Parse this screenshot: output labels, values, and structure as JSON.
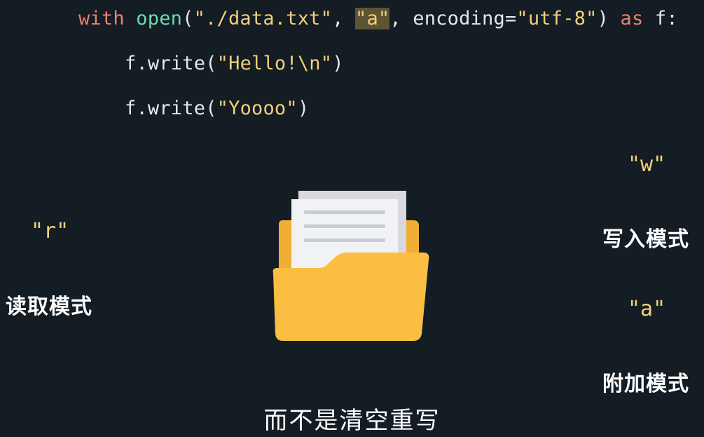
{
  "code": {
    "line1": {
      "kw_with": "with",
      "fn_open": "open",
      "p_open": "(",
      "path": "\"./data.txt\"",
      "comma1": ", ",
      "mode": "\"a\"",
      "rest": ", encoding=",
      "enc": "\"utf-8\"",
      "p_close": ") ",
      "kw_as": "as",
      "tail": " f:"
    },
    "line2": {
      "call": "f.write(",
      "arg": "\"Hello!\\n\"",
      "close": ")"
    },
    "line3": {
      "call": "f.write(",
      "arg": "\"Yoooo\"",
      "close": ")"
    }
  },
  "modes": {
    "read": {
      "token": "\"r\"",
      "label": "读取模式"
    },
    "write": {
      "token": "\"w\"",
      "label": "写入模式"
    },
    "append": {
      "token": "\"a\"",
      "label": "附加模式"
    }
  },
  "subtitle": "而不是清空重写",
  "icons": {
    "folder": "folder-document-icon"
  },
  "colors": {
    "background": "#141c24",
    "keyword": "#e8846e",
    "function": "#6fd9b0",
    "string": "#f2cf7a",
    "highlight": "#5c5432",
    "folder": "#fbbd42"
  }
}
